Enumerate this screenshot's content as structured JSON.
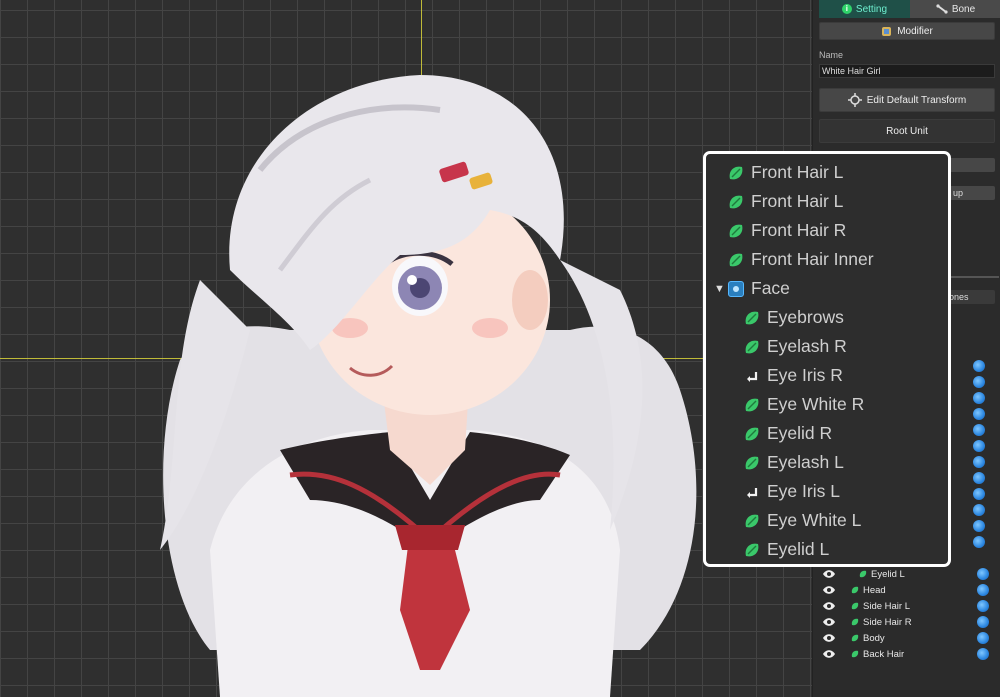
{
  "panel": {
    "tabs": [
      {
        "label": "Setting",
        "icon": "info-icon",
        "active": true
      },
      {
        "label": "Bone",
        "icon": "bone-icon",
        "active": false
      }
    ],
    "modifier_label": "Modifier",
    "name_label": "Name",
    "name_value": "White Hair Girl",
    "edit_transform_label": "Edit Default Transform",
    "root_unit_label": "Root Unit",
    "partial_labels": [
      "up",
      "ones"
    ],
    "layers": [
      {
        "label": "Eyelid L",
        "icon": "mesh-leaf-icon",
        "indent": 1
      },
      {
        "label": "Head",
        "icon": "mesh-leaf-icon",
        "indent": 0
      },
      {
        "label": "Side Hair L",
        "icon": "mesh-leaf-icon",
        "indent": 0
      },
      {
        "label": "Side Hair R",
        "icon": "mesh-leaf-icon",
        "indent": 0
      },
      {
        "label": "Body",
        "icon": "mesh-leaf-icon",
        "indent": 0
      },
      {
        "label": "Back Hair",
        "icon": "mesh-leaf-icon",
        "indent": 0
      }
    ]
  },
  "popup": {
    "rows": [
      {
        "label": "Front Hair L",
        "icon": "mesh-leaf-icon",
        "indent": 0
      },
      {
        "label": "Front Hair L",
        "icon": "mesh-leaf-icon",
        "indent": 0
      },
      {
        "label": "Front Hair R",
        "icon": "mesh-leaf-icon",
        "indent": 0
      },
      {
        "label": "Front Hair Inner",
        "icon": "mesh-leaf-icon",
        "indent": 0
      },
      {
        "label": "Face",
        "icon": "face-group-icon",
        "indent": 0,
        "expanded": true
      },
      {
        "label": "Eyebrows",
        "icon": "mesh-leaf-icon",
        "indent": 1
      },
      {
        "label": "Eyelash R",
        "icon": "mesh-leaf-icon",
        "indent": 1
      },
      {
        "label": "Eye Iris R",
        "icon": "child-arrow-icon",
        "indent": 1
      },
      {
        "label": "Eye White R",
        "icon": "mesh-leaf-icon",
        "indent": 1
      },
      {
        "label": "Eyelid R",
        "icon": "mesh-leaf-icon",
        "indent": 1
      },
      {
        "label": "Eyelash L",
        "icon": "mesh-leaf-icon",
        "indent": 1
      },
      {
        "label": "Eye Iris L",
        "icon": "child-arrow-icon",
        "indent": 1
      },
      {
        "label": "Eye White L",
        "icon": "mesh-leaf-icon",
        "indent": 1
      },
      {
        "label": "Eyelid L",
        "icon": "mesh-leaf-icon",
        "indent": 1
      }
    ]
  },
  "colors": {
    "accent_tab": "#1f5048",
    "leaf_green": "#3ac86a",
    "axis_yellow": "#d8d23a",
    "popup_border": "#ffffff"
  }
}
